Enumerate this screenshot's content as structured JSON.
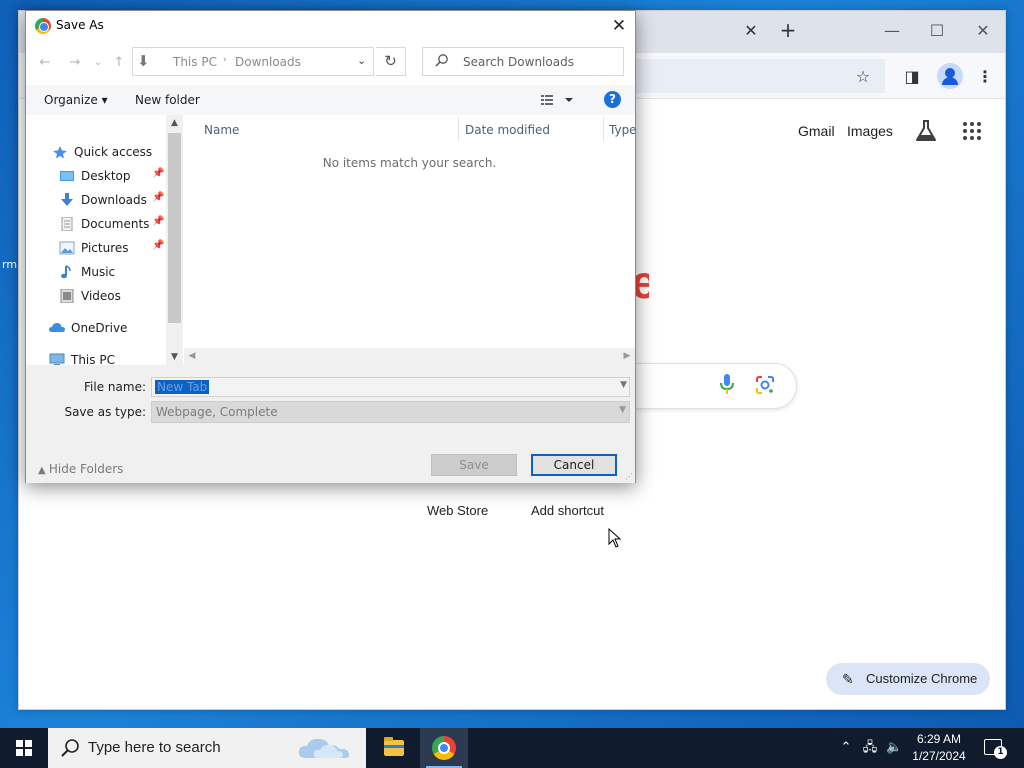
{
  "desktop": {
    "edge_text": "rm"
  },
  "chrome": {
    "tab_close": "✕",
    "new_tab": "+",
    "window_controls": {
      "minimize": "—",
      "maximize": "☐",
      "close": "✕"
    },
    "toolbar": {
      "star": "☆",
      "side_panel": "◨",
      "menu": "⋮"
    },
    "ntp": {
      "gmail_label": "Gmail",
      "images_label": "Images",
      "shortcuts": [
        "Web Store",
        "Add shortcut"
      ],
      "customize_label": "Customize Chrome",
      "customize_icon": "✎",
      "logo_fragment": "e"
    }
  },
  "dialog": {
    "title": "Save As",
    "close": "✕",
    "nav": {
      "back": "←",
      "forward": "→",
      "recent": "⌄",
      "up": "↑",
      "refresh": "↻"
    },
    "address": {
      "segments": [
        "This PC",
        "Downloads"
      ],
      "separator": "›",
      "dropdown": "⌄"
    },
    "search_placeholder": "Search Downloads",
    "commands": {
      "organize": "Organize ▾",
      "new_folder": "New folder",
      "help": "?"
    },
    "nav_pane": {
      "items": [
        {
          "label": "Quick access",
          "icon": "star-icon",
          "pinned": false
        },
        {
          "label": "Desktop",
          "icon": "desktop-folder-icon",
          "pinned": true
        },
        {
          "label": "Downloads",
          "icon": "download-icon",
          "pinned": true
        },
        {
          "label": "Documents",
          "icon": "documents-icon",
          "pinned": true
        },
        {
          "label": "Pictures",
          "icon": "pictures-icon",
          "pinned": true
        },
        {
          "label": "Music",
          "icon": "music-icon",
          "pinned": false
        },
        {
          "label": "Videos",
          "icon": "videos-icon",
          "pinned": false
        },
        {
          "label": "OneDrive",
          "icon": "cloud-icon",
          "pinned": false
        },
        {
          "label": "This PC",
          "icon": "computer-icon",
          "pinned": false
        }
      ],
      "pin_glyph": "📌"
    },
    "columns": [
      "Name",
      "Date modified",
      "Type"
    ],
    "empty_message": "No items match your search.",
    "file_name_label": "File name:",
    "file_name_value": "New Tab",
    "save_as_type_label": "Save as type:",
    "save_as_type_value": "Webpage, Complete",
    "hide_folders_label": "Hide Folders",
    "save_label": "Save",
    "cancel_label": "Cancel"
  },
  "taskbar": {
    "search_placeholder": "Type here to search",
    "time": "6:29 AM",
    "date": "1/27/2024",
    "notification_count": "1",
    "tray": {
      "chevron": "⌃",
      "network": "🖧",
      "volume": "🔈"
    }
  }
}
